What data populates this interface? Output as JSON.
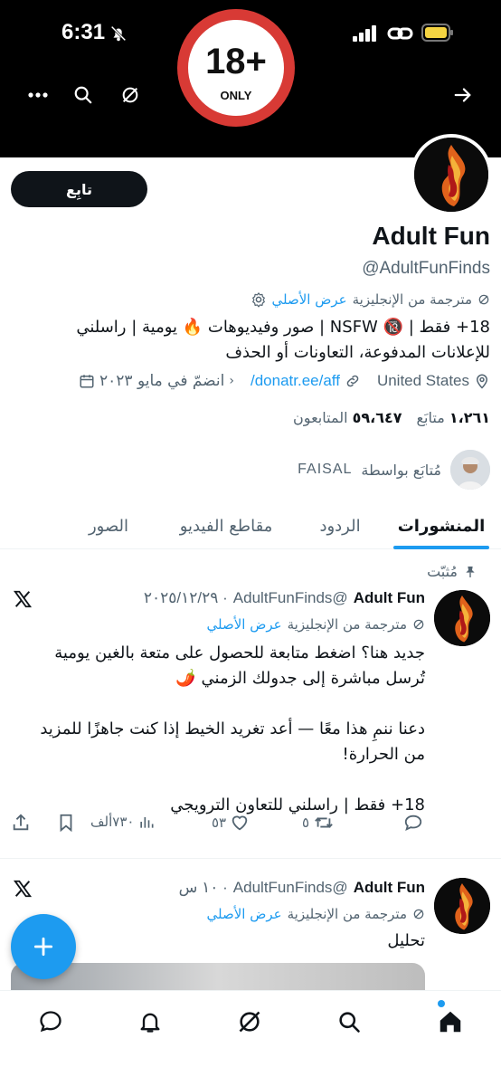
{
  "status_bar": {
    "time": "6:31"
  },
  "banner": {
    "badge_number": "18+",
    "badge_caption": "ONLY"
  },
  "profile": {
    "follow_label": "تابِع",
    "name": "Adult Fun",
    "handle": "@AdultFunFinds",
    "translated_label": "مترجمة من الإنجليزية",
    "show_original": "عرض الأصلي",
    "bio_line1": "18+ فقط | 🔞 NSFW | صور وفيديوهات 🔥 يومية | راسلني",
    "bio_line2": "للإعلانات المدفوعة، التعاونات أو الحذف",
    "location": "United States",
    "website": "donatr.ee/aff/",
    "joined": "انضمّ في مايو ٢٠٢٣",
    "following_count": "١،٢٦١",
    "following_label": "متابَع",
    "followers_count": "٥٩،٦٤٧",
    "followers_label": "المتابعون",
    "followed_by_text": "مُتابَع بواسطة",
    "followed_by_name": "FAISAL"
  },
  "tabs": [
    {
      "label": "المنشورات",
      "active": true
    },
    {
      "label": "الردود",
      "active": false
    },
    {
      "label": "مقاطع الفيديو",
      "active": false
    },
    {
      "label": "الصور",
      "active": false
    }
  ],
  "posts": [
    {
      "pinned_label": "مُثبّت",
      "name": "Adult Fun",
      "handle": "@AdultFunFinds",
      "time": "· ٢٠٢٥/١٢/٢٩",
      "translated_label": "مترجمة من الإنجليزية",
      "show_original": "عرض الأصلي",
      "text_line1": "جديد هنا؟ اضغط متابعة للحصول على متعة بالغين يومية",
      "text_line2": "تُرسل مباشرة إلى جدولك الزمني 🌶️",
      "text_line3": "دعنا ننمِ هذا معًا — أعد تغريد الخيط إذا كنت جاهزًا للمزيد",
      "text_line4": "من الحرارة!",
      "text_line5": "18+ فقط | راسلني للتعاون الترويجي",
      "reposts": "٥",
      "likes": "٥٣",
      "views": "٧٣٠ألف"
    },
    {
      "name": "Adult Fun",
      "handle": "@AdultFunFinds",
      "time": "· ١٠ س",
      "translated_label": "مترجمة من الإنجليزية",
      "show_original": "عرض الأصلي",
      "text_line1": "تحليل"
    }
  ],
  "colors": {
    "accent": "#1d9bf0",
    "text": "#0f1419",
    "muted": "#536471",
    "badge_red": "#d83a35"
  }
}
